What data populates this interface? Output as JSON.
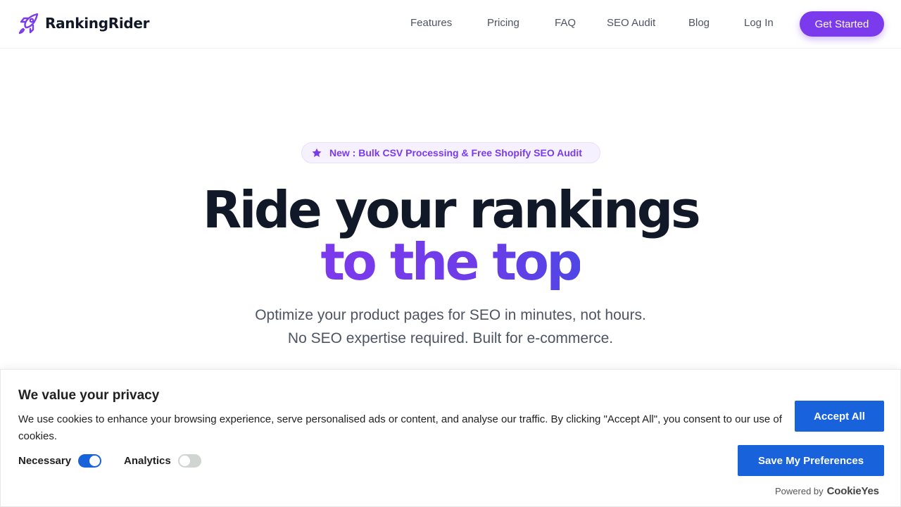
{
  "header": {
    "brand": "RankingRider",
    "nav": [
      {
        "label": "Features"
      },
      {
        "label": "Pricing"
      },
      {
        "label": "FAQ"
      },
      {
        "label": "SEO Audit"
      },
      {
        "label": "Blog"
      },
      {
        "label": "Log In"
      }
    ],
    "cta_label": "Get Started"
  },
  "hero": {
    "badge_icon": "star-icon",
    "badge_text": "New : Bulk CSV Processing & Free Shopify SEO Audit",
    "title_line1": "Ride your rankings",
    "title_line2": "to the top",
    "subtitle_line1": "Optimize your product pages for SEO in minutes, not hours.",
    "subtitle_line2": "No SEO expertise required. Built for e-commerce."
  },
  "cookie_banner": {
    "title": "We value your privacy",
    "description": "We use cookies to enhance your browsing experience, serve personalised ads or content, and analyse our traffic. By clicking \"Accept All\", you consent to our use of cookies.",
    "toggles": [
      {
        "label": "Necessary",
        "checked": true
      },
      {
        "label": "Analytics",
        "checked": false
      }
    ],
    "accept_label": "Accept All",
    "save_label": "Save My Preferences",
    "powered_by": "Powered by",
    "powered_brand": "CookieYes"
  },
  "colors": {
    "brand_purple": "#7c3aed",
    "cookie_blue": "#1863dc",
    "heading_dark": "#111827"
  }
}
